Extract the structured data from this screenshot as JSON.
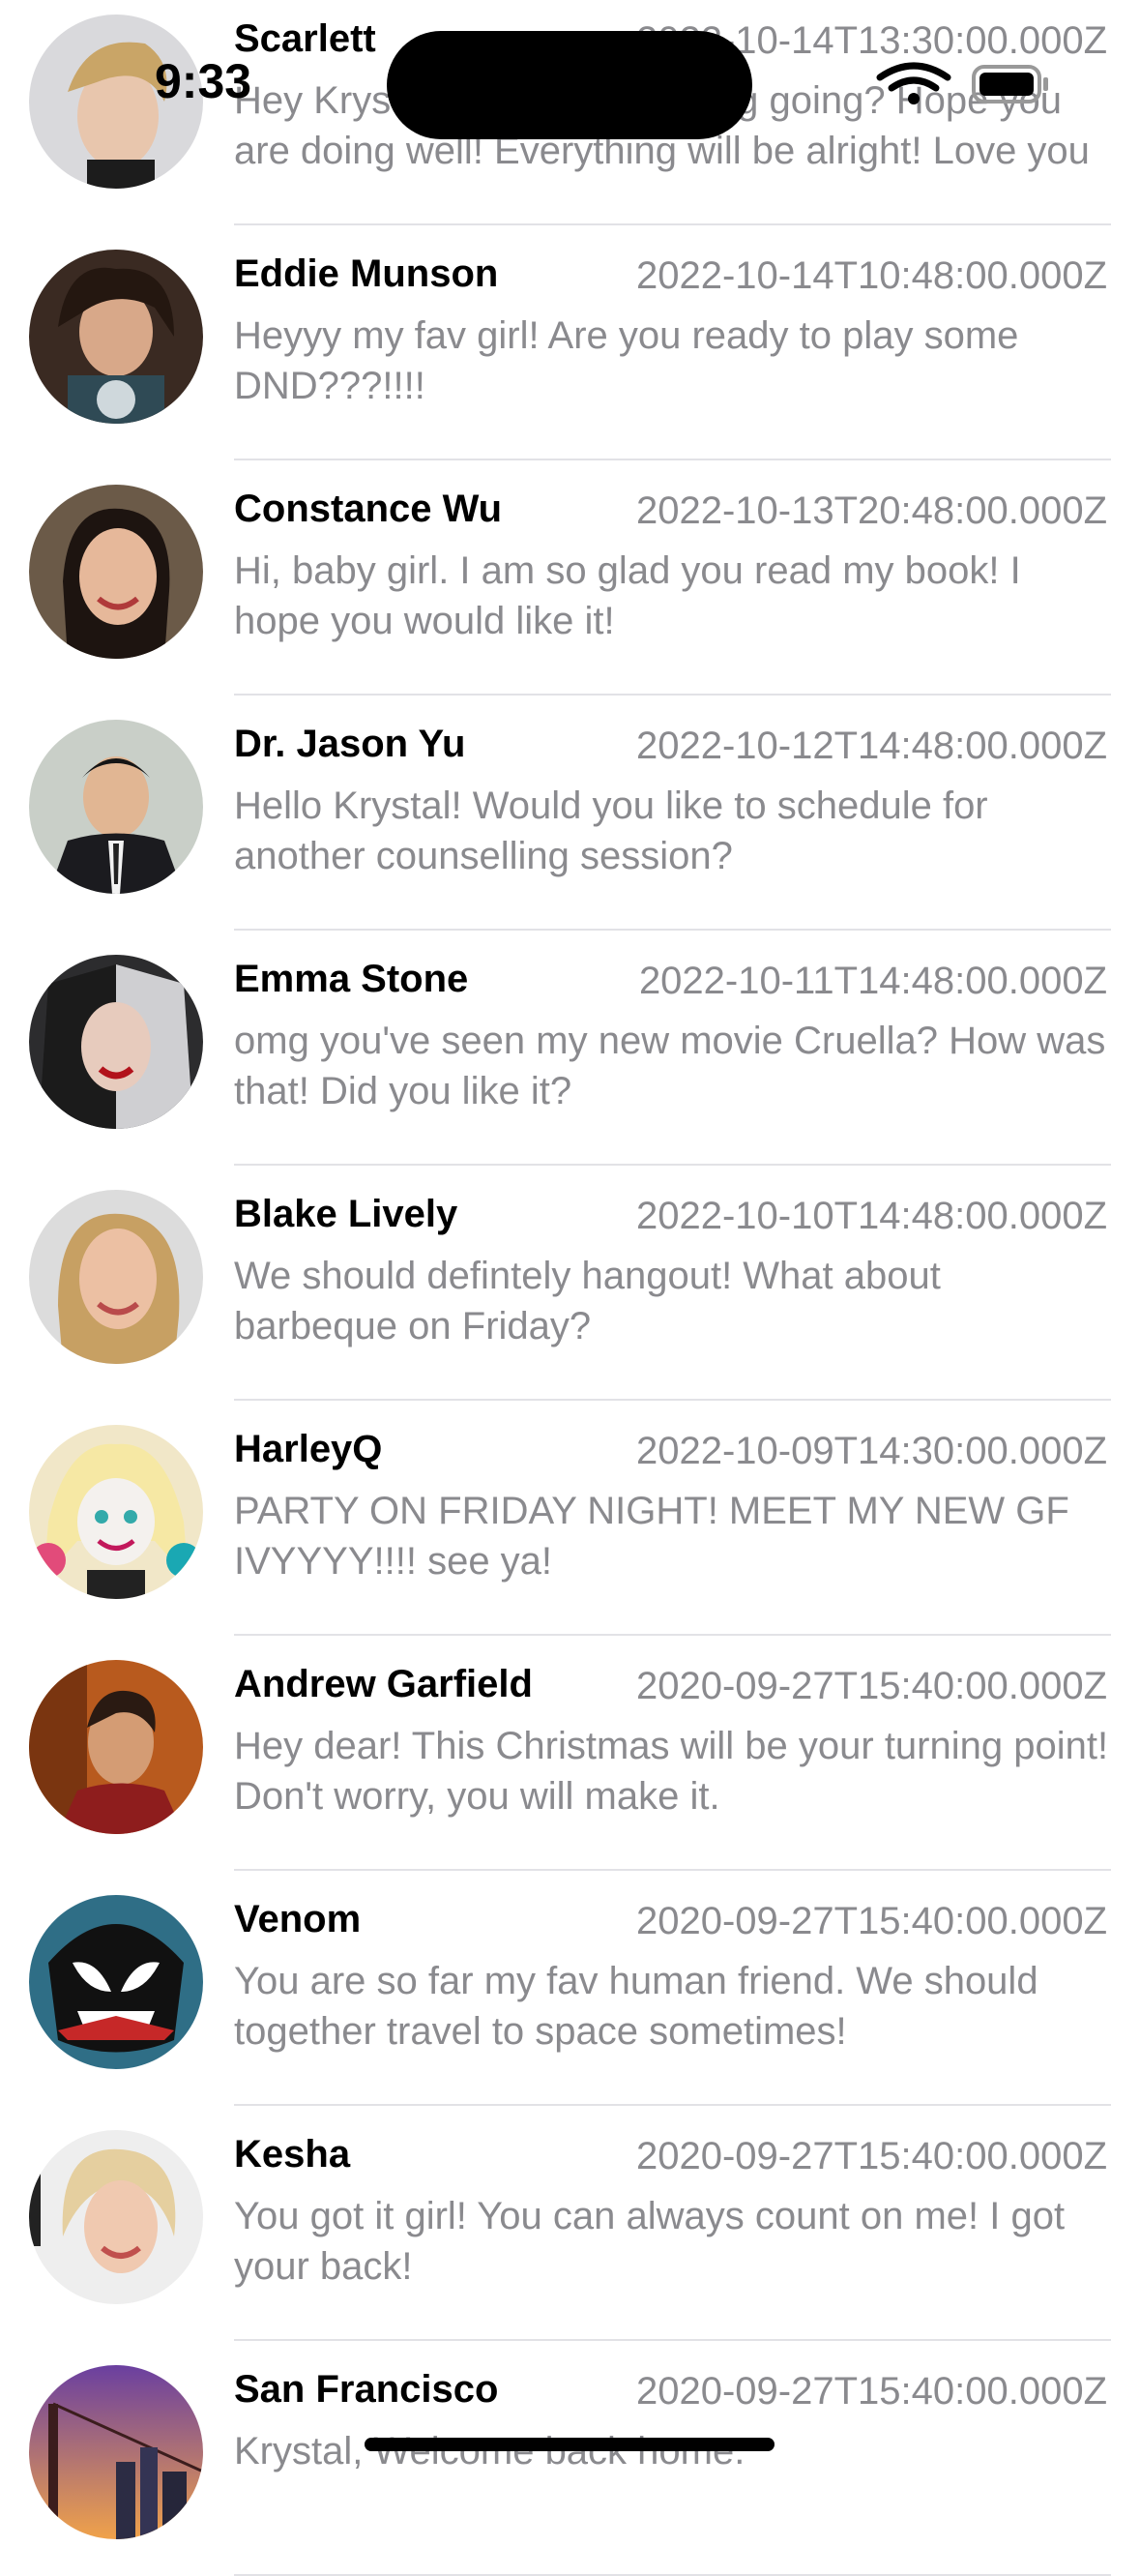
{
  "status_bar": {
    "time": "9:33"
  },
  "conversations": [
    {
      "name": "Scarlett",
      "time": "2022-10-14T13:30:00.000Z",
      "message": "Hey Krystal! How is everything going? Hope you are doing well! Everything will be alright! Love you",
      "avatar": "blonde-woman-avatar-icon"
    },
    {
      "name": "Eddie Munson",
      "time": "2022-10-14T10:48:00.000Z",
      "message": "Heyyy my fav girl! Are you ready to play some DND???!!!!",
      "avatar": "rocker-avatar-icon"
    },
    {
      "name": "Constance Wu",
      "time": "2022-10-13T20:48:00.000Z",
      "message": "Hi, baby girl. I am so glad you read my book! I hope you would like it!",
      "avatar": "woman-avatar-icon"
    },
    {
      "name": "Dr. Jason Yu",
      "time": "2022-10-12T14:48:00.000Z",
      "message": "Hello Krystal! Would you like to schedule for another counselling session?",
      "avatar": "man-in-suit-avatar-icon"
    },
    {
      "name": "Emma Stone",
      "time": "2022-10-11T14:48:00.000Z",
      "message": "omg you've seen my new movie Cruella? How was that! Did you like it?",
      "avatar": "cruella-avatar-icon"
    },
    {
      "name": "Blake Lively",
      "time": "2022-10-10T14:48:00.000Z",
      "message": "We should defintely hangout! What about barbeque on Friday?",
      "avatar": "blonde-woman-avatar-icon"
    },
    {
      "name": "HarleyQ",
      "time": "2022-10-09T14:30:00.000Z",
      "message": "PARTY ON FRIDAY NIGHT! MEET MY NEW GF IVYYYY!!!! see ya!",
      "avatar": "cartoon-clown-avatar-icon"
    },
    {
      "name": "Andrew Garfield",
      "time": "2020-09-27T15:40:00.000Z",
      "message": "Hey dear! This Christmas will be your turning point! Don't worry, you will make it.",
      "avatar": "man-avatar-icon"
    },
    {
      "name": "Venom",
      "time": "2020-09-27T15:40:00.000Z",
      "message": "You are so far my fav human friend. We should together travel to space sometimes!",
      "avatar": "venom-avatar-icon"
    },
    {
      "name": "Kesha",
      "time": "2020-09-27T15:40:00.000Z",
      "message": "You got it girl! You can always count on me! I got your back!",
      "avatar": "blonde-woman-avatar-icon"
    },
    {
      "name": "San Francisco",
      "time": "2020-09-27T15:40:00.000Z",
      "message": "Krystal, Welcome back home.",
      "avatar": "city-bridge-avatar-icon"
    }
  ]
}
